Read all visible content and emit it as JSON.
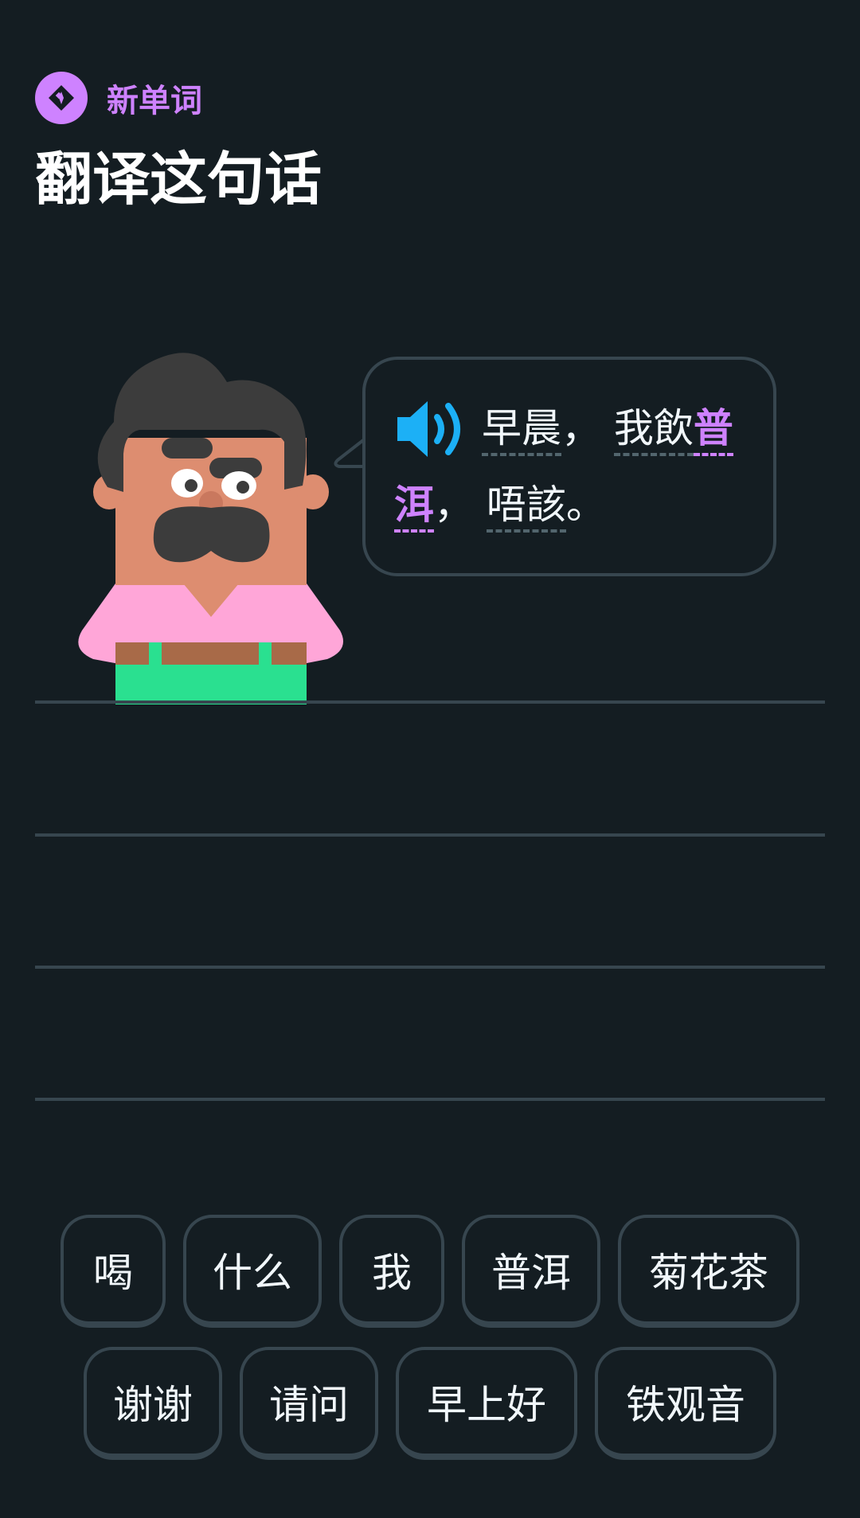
{
  "header": {
    "badge_label": "新单词",
    "title": "翻译这句话"
  },
  "prompt": {
    "speaker_icon": "speaker-icon",
    "tokens": [
      {
        "text": "早晨",
        "kind": "word"
      },
      {
        "text": "，",
        "kind": "punct"
      },
      {
        "text": "我飲",
        "kind": "word"
      },
      {
        "text": "普洱",
        "kind": "new"
      },
      {
        "text": "，",
        "kind": "punct"
      },
      {
        "text": "唔該",
        "kind": "word"
      },
      {
        "text": "。",
        "kind": "punct"
      }
    ]
  },
  "word_bank": {
    "row1": [
      "喝",
      "什么",
      "我",
      "普洱",
      "菊花茶"
    ],
    "row2": [
      "谢谢",
      "请问",
      "早上好",
      "铁观音"
    ]
  },
  "colors": {
    "background": "#141d22",
    "accent_new_word": "#ce82ff",
    "speaker_blue": "#1cb0f6",
    "border": "#37464f"
  }
}
